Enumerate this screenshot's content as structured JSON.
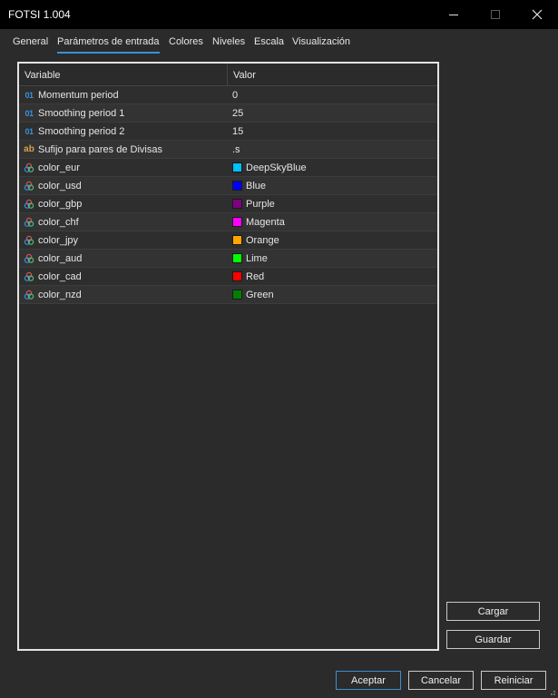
{
  "window": {
    "title": "FOTSI 1.004"
  },
  "tabs": [
    {
      "label": "General"
    },
    {
      "label": "Parámetros de entrada"
    },
    {
      "label": "Colores"
    },
    {
      "label": "Niveles"
    },
    {
      "label": "Escala"
    },
    {
      "label": "Visualización"
    }
  ],
  "active_tab": "Parámetros de entrada",
  "table": {
    "headers": {
      "variable": "Variable",
      "value": "Valor"
    },
    "rows": [
      {
        "icon": "01",
        "name": "Momentum period",
        "value": "0"
      },
      {
        "icon": "01",
        "name": "Smoothing period 1",
        "value": "25"
      },
      {
        "icon": "01",
        "name": "Smoothing period 2",
        "value": "15"
      },
      {
        "icon": "ab",
        "name": "Sufijo para pares de Divisas",
        "value": ".s"
      },
      {
        "name": "color_eur",
        "value": "DeepSkyBlue",
        "color": "#00bfff"
      },
      {
        "name": "color_usd",
        "value": "Blue",
        "color": "#0000ff"
      },
      {
        "name": "color_gbp",
        "value": "Purple",
        "color": "#800080"
      },
      {
        "name": "color_chf",
        "value": "Magenta",
        "color": "#ff00ff"
      },
      {
        "name": "color_jpy",
        "value": "Orange",
        "color": "#ffa500"
      },
      {
        "name": "color_aud",
        "value": "Lime",
        "color": "#00ff00"
      },
      {
        "name": "color_cad",
        "value": "Red",
        "color": "#ff0000"
      },
      {
        "name": "color_nzd",
        "value": "Green",
        "color": "#008000"
      }
    ]
  },
  "buttons": {
    "load": "Cargar",
    "save": "Guardar",
    "ok": "Aceptar",
    "cancel": "Cancelar",
    "reset": "Reiniciar"
  },
  "colors": {
    "titlebar": "#000000",
    "background": "#2b2b2b",
    "accent": "#3a8ed8"
  }
}
